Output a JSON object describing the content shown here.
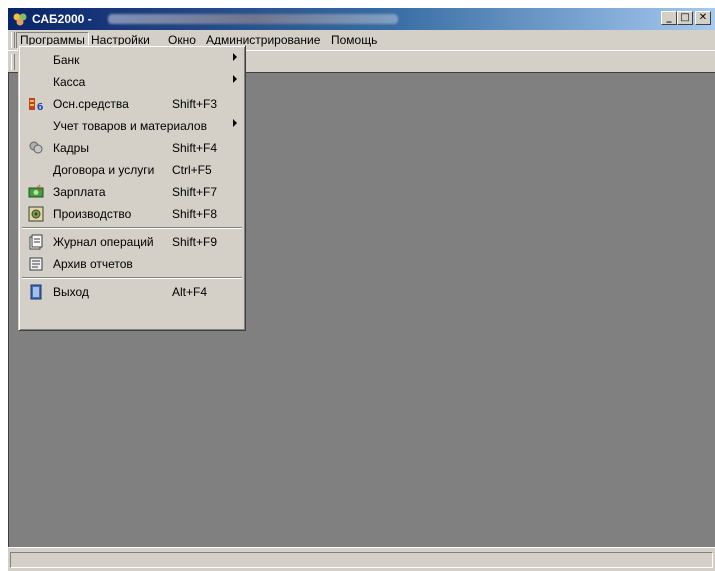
{
  "window": {
    "title": "САБ2000 -",
    "controls": {
      "minimize": "_",
      "maximize": "□",
      "close": "✕"
    }
  },
  "menubar": {
    "items": [
      "Программы",
      "Настройки",
      "Окно",
      "Администрирование",
      "Помощь"
    ]
  },
  "programs_menu": {
    "items": [
      {
        "label": "Банк",
        "shortcut": "",
        "submenu": true,
        "icon": ""
      },
      {
        "label": "Касса",
        "shortcut": "",
        "submenu": true,
        "icon": ""
      },
      {
        "label": "Осн.средства",
        "shortcut": "Shift+F3",
        "submenu": false,
        "icon": "fixed-assets-icon"
      },
      {
        "label": "Учет товаров и материалов",
        "shortcut": "",
        "submenu": true,
        "icon": ""
      },
      {
        "label": "Кадры",
        "shortcut": "Shift+F4",
        "submenu": false,
        "icon": "personnel-icon"
      },
      {
        "label": "Договора и услуги",
        "shortcut": "Ctrl+F5",
        "submenu": false,
        "icon": ""
      },
      {
        "label": "Зарплата",
        "shortcut": "Shift+F7",
        "submenu": false,
        "icon": "salary-icon"
      },
      {
        "label": "Производство",
        "shortcut": "Shift+F8",
        "submenu": false,
        "icon": "production-icon"
      },
      {
        "label": "Журнал операций",
        "shortcut": "Shift+F9",
        "submenu": false,
        "icon": "journal-icon"
      },
      {
        "label": "Архив отчетов",
        "shortcut": "",
        "submenu": false,
        "icon": "report-archive-icon"
      },
      {
        "label": "Выход",
        "shortcut": "Alt+F4",
        "submenu": false,
        "icon": "exit-icon"
      }
    ]
  },
  "colors": {
    "titlebar_start": "#0a246a",
    "titlebar_end": "#a6caf0",
    "face": "#d4d0c8",
    "workspace": "#808080"
  }
}
